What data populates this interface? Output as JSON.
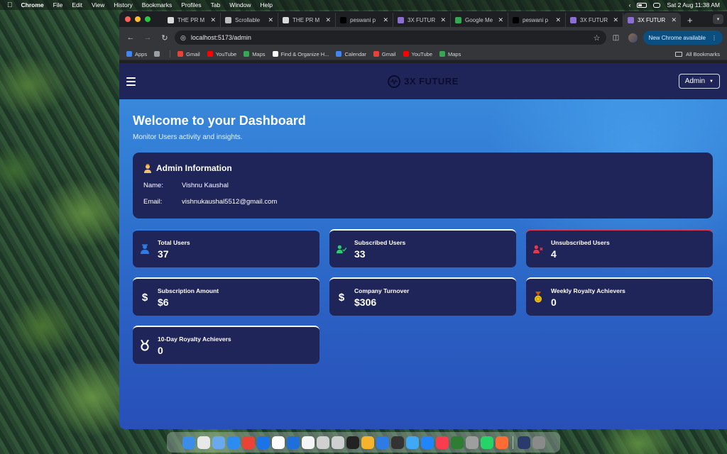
{
  "menubar": {
    "app_name": "Chrome",
    "menus": [
      "File",
      "Edit",
      "View",
      "History",
      "Bookmarks",
      "Profiles",
      "Tab",
      "Window",
      "Help"
    ],
    "datetime": "Sat 2 Aug  11:38 AM"
  },
  "browser": {
    "tabs": [
      {
        "label": "THE PR M",
        "color": "#d9d9d9"
      },
      {
        "label": "Scrollable",
        "color": "#bfbfbf"
      },
      {
        "label": "THE PR M",
        "color": "#d9d9d9"
      },
      {
        "label": "peswani p",
        "color": "#000000"
      },
      {
        "label": "3X FUTUR",
        "color": "#8d6fd1"
      },
      {
        "label": "Google Me",
        "color": "#34a853"
      },
      {
        "label": "peswani p",
        "color": "#000000"
      },
      {
        "label": "3X FUTUR",
        "color": "#8d6fd1"
      },
      {
        "label": "3X FUTUR",
        "color": "#8d6fd1",
        "active": true
      }
    ],
    "new_tab": "+",
    "url": "localhost:5173/admin",
    "new_chrome_label": "New Chrome available",
    "bookmarks": [
      {
        "label": "Apps",
        "color": "#4285f4"
      },
      {
        "label": "",
        "color": "#9aa0a6"
      },
      {
        "label": "Gmail",
        "color": "#ea4335"
      },
      {
        "label": "YouTube",
        "color": "#ff0000"
      },
      {
        "label": "Maps",
        "color": "#34a853"
      },
      {
        "label": "Find & Organize H...",
        "color": "#ffffff"
      },
      {
        "label": "Calendar",
        "color": "#4285f4"
      },
      {
        "label": "Gmail",
        "color": "#ea4335"
      },
      {
        "label": "YouTube",
        "color": "#ff0000"
      },
      {
        "label": "Maps",
        "color": "#34a853"
      }
    ],
    "all_bookmarks": "All Bookmarks"
  },
  "site": {
    "brand": "3X FUTURE",
    "admin_button": "Admin",
    "welcome_title": "Welcome to your Dashboard",
    "welcome_subtitle": "Monitor Users activity and insights.",
    "admin_info": {
      "title": "Admin Information",
      "name_label": "Name:",
      "name": "Vishnu Kaushal",
      "email_label": "Email:",
      "email": "vishnukaushal5512@gmail.com"
    },
    "stats": [
      {
        "label": "Total Users",
        "value": "37",
        "icon": "users-icon",
        "accent": "#2f7be6"
      },
      {
        "label": "Subscribed Users",
        "value": "33",
        "icon": "user-check-icon",
        "accent": "#2ecc71"
      },
      {
        "label": "Unsubscribed Users",
        "value": "4",
        "icon": "user-x-icon",
        "accent": "#e23a4f"
      },
      {
        "label": "Subscription Amount",
        "value": "$6",
        "icon": "dollar-icon",
        "accent": "#ffffff"
      },
      {
        "label": "Company Turnover",
        "value": "$306",
        "icon": "dollar-icon",
        "accent": "#ffffff"
      },
      {
        "label": "Weekly Royalty Achievers",
        "value": "0",
        "icon": "medal-icon",
        "accent": "#f1c40f"
      },
      {
        "label": "10-Day Royalty Achievers",
        "value": "0",
        "icon": "award-icon",
        "accent": "#ffffff"
      }
    ]
  },
  "colors": {
    "nav_bg": "#1f2459",
    "card_bg": "#1f2459",
    "page_gradient_top": "#3b8fe0",
    "page_gradient_bottom": "#2850b8"
  },
  "dock": {
    "apps": [
      "#3b8de8",
      "#e8e8e8",
      "#6aa8f0",
      "#2d8cf0",
      "#ea4335",
      "#1a73e8",
      "#ffffff",
      "#1e6fd9",
      "#f5f5f5",
      "#d0d0d0",
      "#cfcfcf",
      "#222222",
      "#f7b32b",
      "#2f7be6",
      "#333333",
      "#3fa9f5",
      "#1f86ff",
      "#fb3c4c",
      "#2e7d32",
      "#9e9e9e",
      "#25d366",
      "#ff6b35",
      "#2a3a6a",
      "#8a8a8a"
    ]
  }
}
